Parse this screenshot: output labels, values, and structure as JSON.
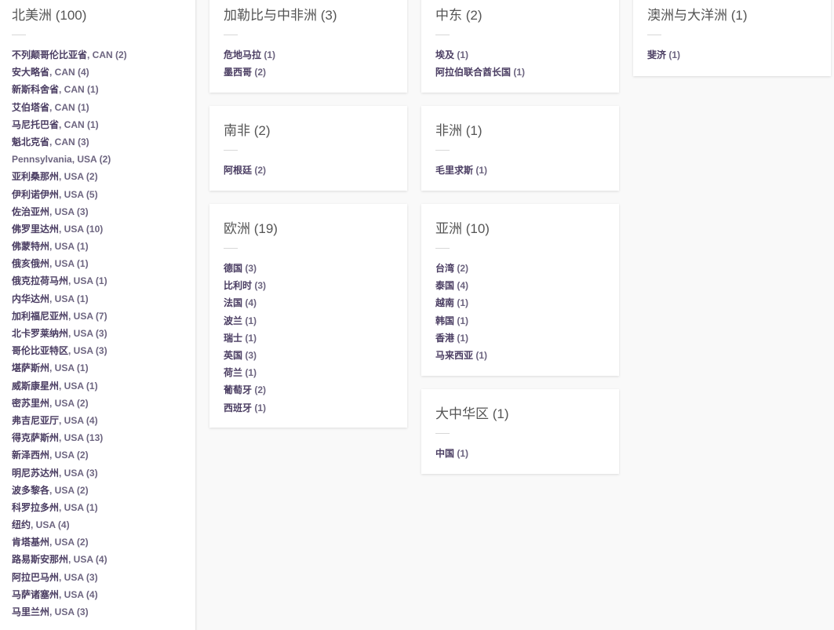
{
  "regions": {
    "north_america": {
      "title": "北美洲 (100)",
      "items": [
        {
          "name": "不列颠哥伦比亚省",
          "suffix": ", CAN (2)"
        },
        {
          "name": "安大略省",
          "suffix": ", CAN (4)"
        },
        {
          "name": "新斯科舍省",
          "suffix": ", CAN (1)"
        },
        {
          "name": "艾伯塔省",
          "suffix": ", CAN (1)"
        },
        {
          "name": "马尼托巴省",
          "suffix": ", CAN (1)"
        },
        {
          "name": "魁北克省",
          "suffix": ", CAN (3)"
        },
        {
          "name": "Pennsylvania",
          "suffix": ", USA (2)"
        },
        {
          "name": "亚利桑那州",
          "suffix": ", USA (2)"
        },
        {
          "name": "伊利诺伊州",
          "suffix": ", USA (5)"
        },
        {
          "name": "佐治亚州",
          "suffix": ", USA (3)"
        },
        {
          "name": "佛罗里达州",
          "suffix": ", USA (10)"
        },
        {
          "name": "佛蒙特州",
          "suffix": ", USA (1)"
        },
        {
          "name": "俄亥俄州",
          "suffix": ", USA (1)"
        },
        {
          "name": "俄克拉荷马州",
          "suffix": ", USA (1)"
        },
        {
          "name": "内华达州",
          "suffix": ", USA (1)"
        },
        {
          "name": "加利福尼亚州",
          "suffix": ", USA (7)"
        },
        {
          "name": "北卡罗莱纳州",
          "suffix": ", USA (3)"
        },
        {
          "name": "哥伦比亚特区",
          "suffix": ", USA (3)"
        },
        {
          "name": "堪萨斯州",
          "suffix": ", USA (1)"
        },
        {
          "name": "威斯康星州",
          "suffix": ", USA (1)"
        },
        {
          "name": "密苏里州",
          "suffix": ", USA (2)"
        },
        {
          "name": "弗吉尼亚厅",
          "suffix": ", USA (4)"
        },
        {
          "name": "得克萨斯州",
          "suffix": ", USA (13)"
        },
        {
          "name": "新泽西州",
          "suffix": ", USA (2)"
        },
        {
          "name": "明尼苏达州",
          "suffix": ", USA (3)"
        },
        {
          "name": "波多黎各",
          "suffix": ", USA (2)"
        },
        {
          "name": "科罗拉多州",
          "suffix": ", USA (1)"
        },
        {
          "name": "纽约",
          "suffix": ", USA (4)"
        },
        {
          "name": "肯塔基州",
          "suffix": ", USA (2)"
        },
        {
          "name": "路易斯安那州",
          "suffix": ", USA (4)"
        },
        {
          "name": "阿拉巴马州",
          "suffix": ", USA (3)"
        },
        {
          "name": "马萨诸塞州",
          "suffix": ", USA (4)"
        },
        {
          "name": "马里兰州",
          "suffix": ", USA (3)"
        }
      ]
    },
    "caribbean": {
      "title": "加勒比与中非洲 (3)",
      "items": [
        {
          "name": "危地马拉",
          "suffix": " (1)"
        },
        {
          "name": "墨西哥",
          "suffix": " (2)"
        }
      ]
    },
    "middle_east": {
      "title": "中东 (2)",
      "items": [
        {
          "name": "埃及",
          "suffix": " (1)"
        },
        {
          "name": "阿拉伯联合酋长国",
          "suffix": " (1)"
        }
      ]
    },
    "oceania": {
      "title": "澳洲与大洋洲 (1)",
      "items": [
        {
          "name": "斐济",
          "suffix": " (1)"
        }
      ]
    },
    "south_america": {
      "title": "南非 (2)",
      "items": [
        {
          "name": "阿根廷",
          "suffix": " (2)"
        }
      ]
    },
    "africa": {
      "title": "非洲 (1)",
      "items": [
        {
          "name": "毛里求斯",
          "suffix": " (1)"
        }
      ]
    },
    "europe": {
      "title": "欧洲 (19)",
      "items": [
        {
          "name": "德国",
          "suffix": " (3)"
        },
        {
          "name": "比利时",
          "suffix": " (3)"
        },
        {
          "name": "法国",
          "suffix": " (4)"
        },
        {
          "name": "波兰",
          "suffix": " (1)"
        },
        {
          "name": "瑞士",
          "suffix": " (1)"
        },
        {
          "name": "英国",
          "suffix": " (3)"
        },
        {
          "name": "荷兰",
          "suffix": " (1)"
        },
        {
          "name": "葡萄牙",
          "suffix": " (2)"
        },
        {
          "name": "西班牙",
          "suffix": " (1)"
        }
      ]
    },
    "asia": {
      "title": "亚洲 (10)",
      "items": [
        {
          "name": "台湾",
          "suffix": " (2)"
        },
        {
          "name": "泰国",
          "suffix": " (4)"
        },
        {
          "name": "越南",
          "suffix": " (1)"
        },
        {
          "name": "韩国",
          "suffix": " (1)"
        },
        {
          "name": "香港",
          "suffix": " (1)"
        },
        {
          "name": "马来西亚",
          "suffix": " (1)"
        }
      ]
    },
    "greater_china": {
      "title": "大中华区 (1)",
      "items": [
        {
          "name": "中国",
          "suffix": " (1)"
        }
      ]
    }
  }
}
